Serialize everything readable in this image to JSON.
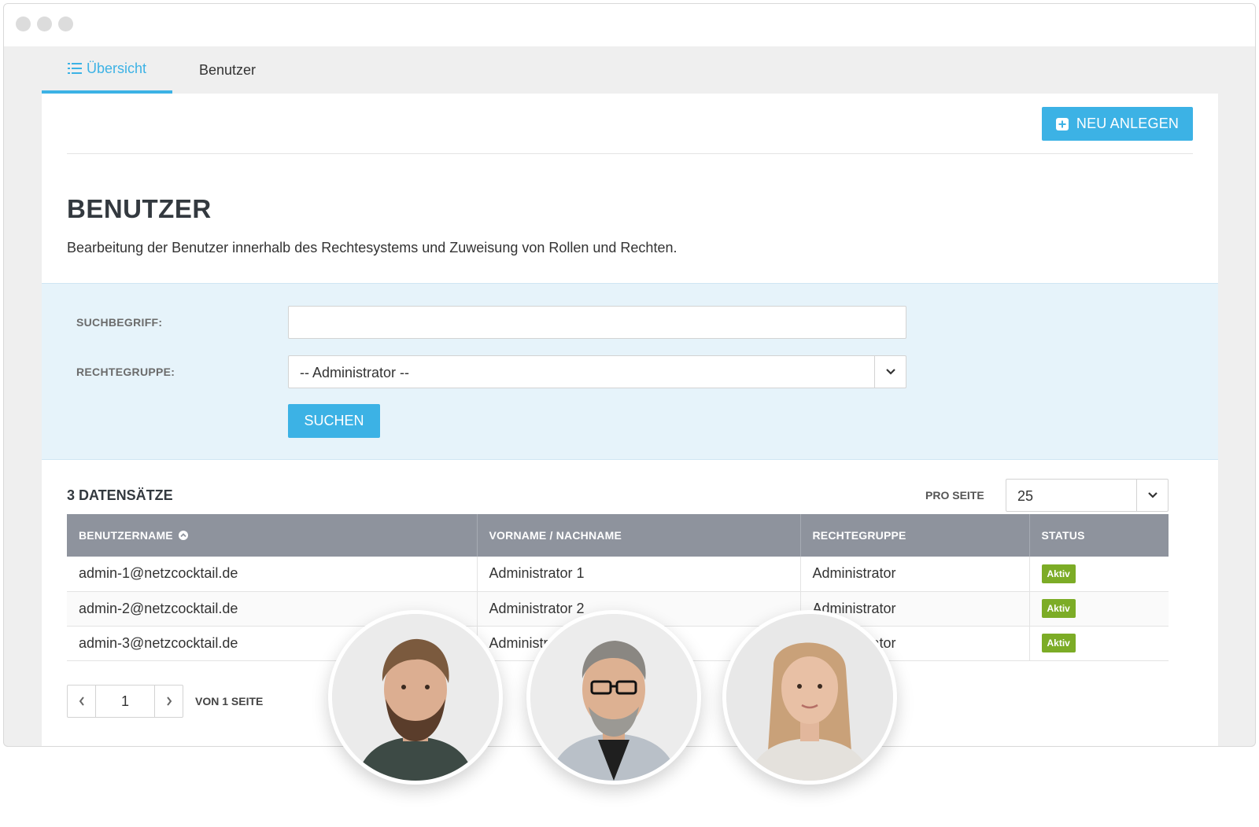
{
  "tabs": [
    {
      "label": "Übersicht",
      "icon": "list-icon",
      "active": true
    },
    {
      "label": "Benutzer",
      "active": false
    }
  ],
  "toolbar": {
    "new_label": "NEU ANLEGEN",
    "new_icon": "plus-square-icon"
  },
  "page": {
    "title": "BENUTZER",
    "description": "Bearbeitung der Benutzer innerhalb des Rechtesystems und Zuweisung von Rollen und Rechten."
  },
  "filter": {
    "search_label": "SUCHBEGRIFF:",
    "search_value": "",
    "group_label": "RECHTEGRUPPE:",
    "group_value": "-- Administrator --",
    "search_button": "SUCHEN"
  },
  "results": {
    "count_label": "3 DATENSÄTZE",
    "per_page_label": "PRO SEITE",
    "per_page_value": "25"
  },
  "table": {
    "headers": [
      "BENUTZERNAME",
      "VORNAME / NACHNAME",
      "RECHTEGRUPPE",
      "STATUS"
    ],
    "rows": [
      {
        "username": "admin-1@netzcocktail.de",
        "name": "Administrator 1",
        "group": "Administrator",
        "status": "Aktiv"
      },
      {
        "username": "admin-2@netzcocktail.de",
        "name": "Administrator 2",
        "group": "Administrator",
        "status": "Aktiv"
      },
      {
        "username": "admin-3@netzcocktail.de",
        "name": "Administrator 3",
        "group": "Administrator",
        "status": "Aktiv"
      }
    ]
  },
  "pagination": {
    "current_page": "1",
    "of_label": "VON 1 SEITE"
  },
  "colors": {
    "accent": "#3cb2e5",
    "status_active": "#7cac26",
    "table_header": "#8e939d",
    "filter_bg": "#e6f3fa"
  }
}
